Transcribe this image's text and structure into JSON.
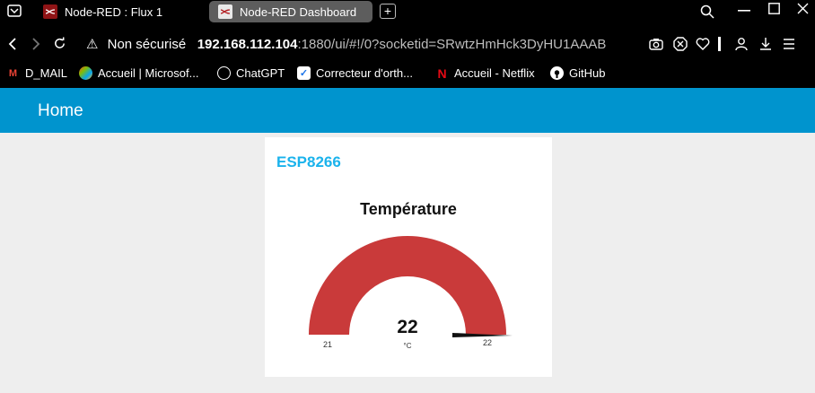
{
  "browser": {
    "tabs": [
      {
        "title": "Node-RED : Flux 1",
        "active": false
      },
      {
        "title": "Node-RED Dashboard",
        "active": true
      }
    ],
    "new_tab_label": "+",
    "address": {
      "security_label": "Non sécurisé",
      "host": "192.168.112.104",
      "path": ":1880/ui/#!/0?socketid=SRwtzHmHck3DyHU1AAAB"
    },
    "bookmarks": [
      {
        "label": "D_MAIL",
        "icon": "gmail-icon"
      },
      {
        "label": "Accueil | Microsof...",
        "icon": "microsoft-icon"
      },
      {
        "label": "ChatGPT",
        "icon": "chatgpt-icon"
      },
      {
        "label": "Correcteur d'orth...",
        "icon": "spellcheck-icon"
      },
      {
        "label": "Accueil - Netflix",
        "icon": "netflix-icon"
      },
      {
        "label": "GitHub",
        "icon": "github-icon"
      }
    ]
  },
  "dashboard": {
    "header_title": "Home",
    "accent_color": "#0094ce",
    "group": {
      "title": "ESP8266",
      "widget": {
        "type": "gauge",
        "title": "Température",
        "value": "22",
        "units": "°C",
        "min": "21",
        "max": "22",
        "fill_color": "#c93a3a",
        "fill_fraction": 1.0
      }
    }
  }
}
